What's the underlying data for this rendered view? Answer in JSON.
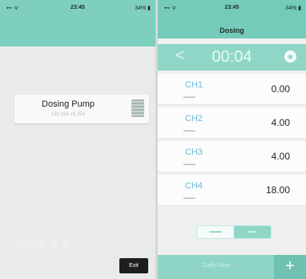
{
  "left": {
    "status": {
      "time": "23:45",
      "battery": "34%"
    },
    "device": {
      "name": "Dosing Pump",
      "ip": "192.168.16.254"
    },
    "exit_label": "Exit"
  },
  "right": {
    "status": {
      "time": "23:45",
      "battery": "34%"
    },
    "title": "Dosing",
    "timer": "00:04",
    "channels": [
      {
        "name": "CH1",
        "value": "0.00"
      },
      {
        "name": "CH2",
        "value": "4.00"
      },
      {
        "name": "CH3",
        "value": "4.00"
      },
      {
        "name": "CH4",
        "value": "18.00"
      }
    ],
    "bottom_label": "Daily Value",
    "add_label": "+"
  },
  "colors": {
    "accent": "#74cbb9",
    "channel_label": "#6fb9d9"
  },
  "icons": {
    "back": "chevron-left-icon",
    "menu": "menu-circle-icon",
    "add": "plus-icon",
    "device": "device-thumbnail-icon",
    "wifi": "wifi-icon",
    "battery": "battery-icon"
  }
}
